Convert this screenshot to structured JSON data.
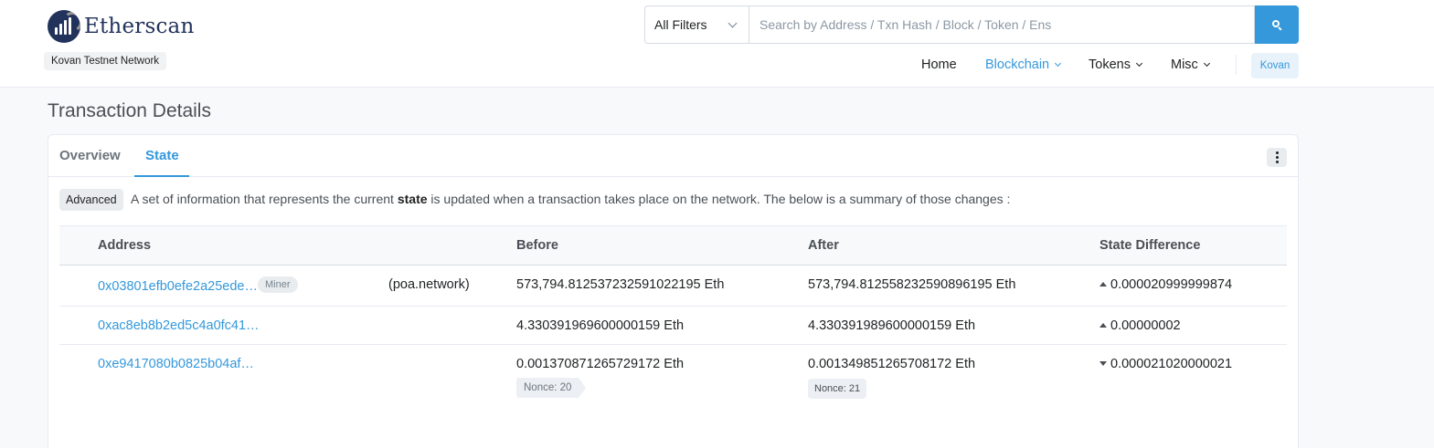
{
  "header": {
    "logo_text": "Etherscan",
    "network_label": "Kovan Testnet Network",
    "search": {
      "filter_label": "All Filters",
      "placeholder": "Search by Address / Txn Hash / Block / Token / Ens"
    },
    "nav": {
      "home": "Home",
      "blockchain": "Blockchain",
      "tokens": "Tokens",
      "misc": "Misc",
      "network_button": "Kovan"
    }
  },
  "page": {
    "title": "Transaction Details"
  },
  "tabs": {
    "overview": "Overview",
    "state": "State",
    "active": "State"
  },
  "state": {
    "badge": "Advanced",
    "desc_before": "A set of information that represents the current ",
    "desc_bold": "state",
    "desc_after": " is updated when a transaction takes place on the network. The below is a summary of those changes :",
    "columns": {
      "address": "Address",
      "before": "Before",
      "after": "After",
      "diff": "State Difference"
    },
    "rows": [
      {
        "address": "0x03801efb0efe2a25ede…",
        "tag": "Miner",
        "name": "(poa.network)",
        "before": "573,794.812537232591022195 Eth",
        "after": "573,794.812558232590896195 Eth",
        "direction": "up",
        "diff": "0.000020999999874"
      },
      {
        "address": "0xac8eb8b2ed5c4a0fc41…",
        "before": "4.330391969600000159 Eth",
        "after": "4.330391989600000159 Eth",
        "direction": "up",
        "diff": "0.00000002"
      },
      {
        "address": "0xe9417080b0825b04af…",
        "before": "0.001370871265729172 Eth",
        "before_nonce": "Nonce: 20",
        "after": "0.001349851265708172 Eth",
        "after_nonce": "Nonce: 21",
        "direction": "down",
        "diff": "0.000021020000021"
      }
    ]
  },
  "colors": {
    "primary": "#3498db",
    "brand": "#21325b",
    "text": "#1e2022",
    "muted": "#77838f"
  }
}
